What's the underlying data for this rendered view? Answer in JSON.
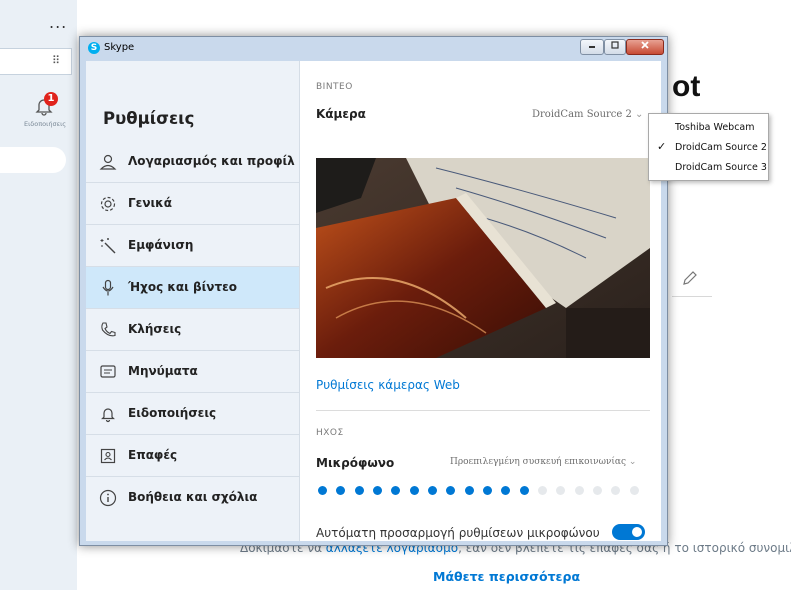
{
  "background": {
    "more_label": "...",
    "notification_badge": "1",
    "notifications_label": "Ειδοποιήσεις",
    "title_fragment": "ot",
    "bottom_text_before": "Δοκιμάστε να ",
    "bottom_text_link": "αλλάξετε λογαριασμό",
    "bottom_text_after": ", εάν δεν βλέπετε τις επαφές σας ή το ιστορικό συνομιλίας.",
    "learn_more": "Μάθετε περισσότερα"
  },
  "window": {
    "title": "Skype",
    "logo_letter": "S"
  },
  "sidebar": {
    "title": "Ρυθμίσεις",
    "items": [
      {
        "label": "Λογαριασμός και προφίλ",
        "icon": "person-icon"
      },
      {
        "label": "Γενικά",
        "icon": "gear-icon"
      },
      {
        "label": "Εμφάνιση",
        "icon": "magic-wand-icon"
      },
      {
        "label": "Ήχος και βίντεο",
        "icon": "microphone-icon",
        "active": true
      },
      {
        "label": "Κλήσεις",
        "icon": "phone-icon"
      },
      {
        "label": "Μηνύματα",
        "icon": "message-icon"
      },
      {
        "label": "Ειδοποιήσεις",
        "icon": "bell-icon"
      },
      {
        "label": "Επαφές",
        "icon": "contacts-icon"
      },
      {
        "label": "Βοήθεια και σχόλια",
        "icon": "info-icon"
      }
    ]
  },
  "video": {
    "section_label": "ΒΙΝΤΕΟ",
    "camera_label": "Κάμερα",
    "camera_selected": "DroidCam Source 2",
    "webcam_settings_link": "Ρυθμίσεις κάμερας Web"
  },
  "audio": {
    "section_label": "ΗΧΟΣ",
    "mic_label": "Μικρόφωνο",
    "mic_selected": "Προεπιλεγμένη συσκευή επικοινωνίας",
    "mic_level_active_dots": 12,
    "mic_level_total_dots": 18,
    "auto_adjust_label": "Αυτόματη προσαρμογή ρυθμίσεων μικροφώνου",
    "auto_adjust_enabled": true
  },
  "camera_dropdown": {
    "options": [
      "Toshiba Webcam",
      "DroidCam Source 2",
      "DroidCam Source 3"
    ],
    "selected_index": 1,
    "check_mark": "✓"
  },
  "colors": {
    "accent": "#0078d4",
    "sidebar_bg": "#edf2f8",
    "active_item_bg": "#cfe8fa",
    "inactive_dot": "#e6e9ec"
  }
}
